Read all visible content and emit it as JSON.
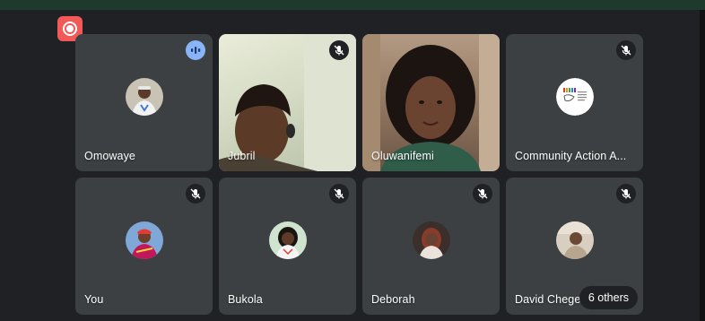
{
  "recording": {
    "icon": "record-icon",
    "color": "#f25a58"
  },
  "participants": [
    {
      "name": "Omowaye",
      "status": "speaking",
      "type": "avatar"
    },
    {
      "name": "Jubril",
      "status": "muted",
      "type": "video"
    },
    {
      "name": "Oluwanifemi",
      "status": "none",
      "type": "video"
    },
    {
      "name": "Community Action A...",
      "status": "muted",
      "type": "logo"
    },
    {
      "name": "You",
      "status": "muted",
      "type": "avatar"
    },
    {
      "name": "Bukola",
      "status": "muted",
      "type": "avatar"
    },
    {
      "name": "Deborah",
      "status": "muted",
      "type": "avatar"
    },
    {
      "name": "David Chege",
      "status": "muted",
      "type": "avatar"
    }
  ],
  "others": {
    "label": "6 others"
  },
  "colors": {
    "tile": "#3c4043",
    "background": "#202124",
    "speaking": "#8ab4f8"
  }
}
